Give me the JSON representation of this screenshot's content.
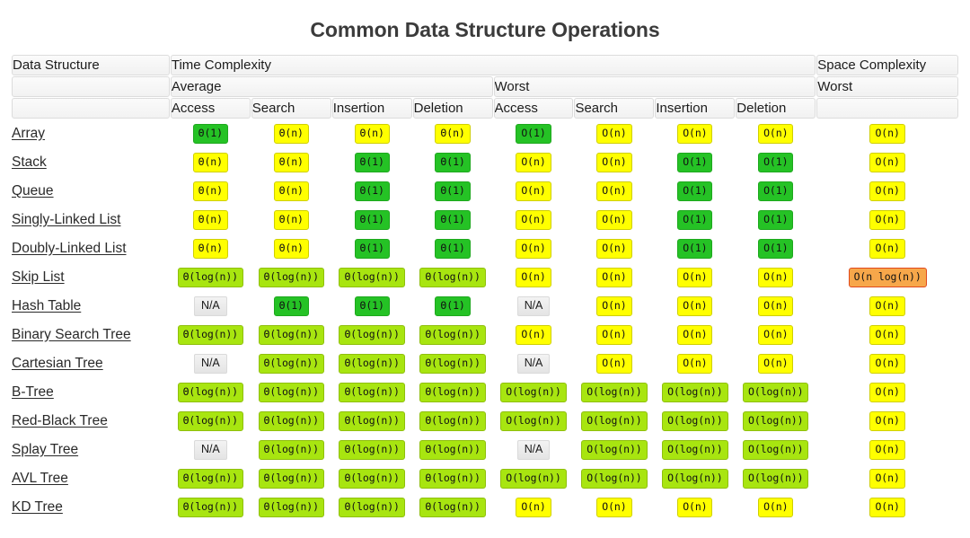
{
  "title": "Common Data Structure Operations",
  "table": {
    "header_row1": [
      {
        "label": "Data Structure",
        "colspan": 1
      },
      {
        "label": "Time Complexity",
        "colspan": 8
      },
      {
        "label": "Space Complexity",
        "colspan": 1
      }
    ],
    "header_row2": [
      {
        "label": "",
        "colspan": 1
      },
      {
        "label": "Average",
        "colspan": 4
      },
      {
        "label": "Worst",
        "colspan": 4
      },
      {
        "label": "Worst",
        "colspan": 1
      }
    ],
    "header_row3": [
      {
        "label": "",
        "colspan": 1
      },
      {
        "label": "Access",
        "colspan": 1
      },
      {
        "label": "Search",
        "colspan": 1
      },
      {
        "label": "Insertion",
        "colspan": 1
      },
      {
        "label": "Deletion",
        "colspan": 1
      },
      {
        "label": "Access",
        "colspan": 1
      },
      {
        "label": "Search",
        "colspan": 1
      },
      {
        "label": "Insertion",
        "colspan": 1
      },
      {
        "label": "Deletion",
        "colspan": 1
      },
      {
        "label": "",
        "colspan": 1
      }
    ],
    "columns": [
      "Data Structure",
      "Average Access",
      "Average Search",
      "Average Insertion",
      "Average Deletion",
      "Worst Access",
      "Worst Search",
      "Worst Insertion",
      "Worst Deletion",
      "Space Worst"
    ],
    "legend_colors": {
      "constant": "#25c225",
      "logarithmic": "#a8e510",
      "linear": "#ffff00",
      "linearithmic": "#f7a74a",
      "not_applicable": "#ebebeb"
    },
    "rows": [
      {
        "name": "Array",
        "cells": [
          {
            "text": "Θ(1)",
            "color": "green"
          },
          {
            "text": "Θ(n)",
            "color": "yellow"
          },
          {
            "text": "Θ(n)",
            "color": "yellow"
          },
          {
            "text": "Θ(n)",
            "color": "yellow"
          },
          {
            "text": "O(1)",
            "color": "green"
          },
          {
            "text": "O(n)",
            "color": "yellow"
          },
          {
            "text": "O(n)",
            "color": "yellow"
          },
          {
            "text": "O(n)",
            "color": "yellow"
          },
          {
            "text": "O(n)",
            "color": "yellow"
          }
        ]
      },
      {
        "name": "Stack",
        "cells": [
          {
            "text": "Θ(n)",
            "color": "yellow"
          },
          {
            "text": "Θ(n)",
            "color": "yellow"
          },
          {
            "text": "Θ(1)",
            "color": "green"
          },
          {
            "text": "Θ(1)",
            "color": "green"
          },
          {
            "text": "O(n)",
            "color": "yellow"
          },
          {
            "text": "O(n)",
            "color": "yellow"
          },
          {
            "text": "O(1)",
            "color": "green"
          },
          {
            "text": "O(1)",
            "color": "green"
          },
          {
            "text": "O(n)",
            "color": "yellow"
          }
        ]
      },
      {
        "name": "Queue",
        "cells": [
          {
            "text": "Θ(n)",
            "color": "yellow"
          },
          {
            "text": "Θ(n)",
            "color": "yellow"
          },
          {
            "text": "Θ(1)",
            "color": "green"
          },
          {
            "text": "Θ(1)",
            "color": "green"
          },
          {
            "text": "O(n)",
            "color": "yellow"
          },
          {
            "text": "O(n)",
            "color": "yellow"
          },
          {
            "text": "O(1)",
            "color": "green"
          },
          {
            "text": "O(1)",
            "color": "green"
          },
          {
            "text": "O(n)",
            "color": "yellow"
          }
        ]
      },
      {
        "name": "Singly-Linked List",
        "cells": [
          {
            "text": "Θ(n)",
            "color": "yellow"
          },
          {
            "text": "Θ(n)",
            "color": "yellow"
          },
          {
            "text": "Θ(1)",
            "color": "green"
          },
          {
            "text": "Θ(1)",
            "color": "green"
          },
          {
            "text": "O(n)",
            "color": "yellow"
          },
          {
            "text": "O(n)",
            "color": "yellow"
          },
          {
            "text": "O(1)",
            "color": "green"
          },
          {
            "text": "O(1)",
            "color": "green"
          },
          {
            "text": "O(n)",
            "color": "yellow"
          }
        ]
      },
      {
        "name": "Doubly-Linked List",
        "cells": [
          {
            "text": "Θ(n)",
            "color": "yellow"
          },
          {
            "text": "Θ(n)",
            "color": "yellow"
          },
          {
            "text": "Θ(1)",
            "color": "green"
          },
          {
            "text": "Θ(1)",
            "color": "green"
          },
          {
            "text": "O(n)",
            "color": "yellow"
          },
          {
            "text": "O(n)",
            "color": "yellow"
          },
          {
            "text": "O(1)",
            "color": "green"
          },
          {
            "text": "O(1)",
            "color": "green"
          },
          {
            "text": "O(n)",
            "color": "yellow"
          }
        ]
      },
      {
        "name": "Skip List",
        "cells": [
          {
            "text": "Θ(log(n))",
            "color": "lime"
          },
          {
            "text": "Θ(log(n))",
            "color": "lime"
          },
          {
            "text": "Θ(log(n))",
            "color": "lime"
          },
          {
            "text": "Θ(log(n))",
            "color": "lime"
          },
          {
            "text": "O(n)",
            "color": "yellow"
          },
          {
            "text": "O(n)",
            "color": "yellow"
          },
          {
            "text": "O(n)",
            "color": "yellow"
          },
          {
            "text": "O(n)",
            "color": "yellow"
          },
          {
            "text": "O(n log(n))",
            "color": "orange"
          }
        ]
      },
      {
        "name": "Hash Table",
        "cells": [
          {
            "text": "N/A",
            "color": "na"
          },
          {
            "text": "Θ(1)",
            "color": "green"
          },
          {
            "text": "Θ(1)",
            "color": "green"
          },
          {
            "text": "Θ(1)",
            "color": "green"
          },
          {
            "text": "N/A",
            "color": "na"
          },
          {
            "text": "O(n)",
            "color": "yellow"
          },
          {
            "text": "O(n)",
            "color": "yellow"
          },
          {
            "text": "O(n)",
            "color": "yellow"
          },
          {
            "text": "O(n)",
            "color": "yellow"
          }
        ]
      },
      {
        "name": "Binary Search Tree",
        "cells": [
          {
            "text": "Θ(log(n))",
            "color": "lime"
          },
          {
            "text": "Θ(log(n))",
            "color": "lime"
          },
          {
            "text": "Θ(log(n))",
            "color": "lime"
          },
          {
            "text": "Θ(log(n))",
            "color": "lime"
          },
          {
            "text": "O(n)",
            "color": "yellow"
          },
          {
            "text": "O(n)",
            "color": "yellow"
          },
          {
            "text": "O(n)",
            "color": "yellow"
          },
          {
            "text": "O(n)",
            "color": "yellow"
          },
          {
            "text": "O(n)",
            "color": "yellow"
          }
        ]
      },
      {
        "name": "Cartesian Tree",
        "cells": [
          {
            "text": "N/A",
            "color": "na"
          },
          {
            "text": "Θ(log(n))",
            "color": "lime"
          },
          {
            "text": "Θ(log(n))",
            "color": "lime"
          },
          {
            "text": "Θ(log(n))",
            "color": "lime"
          },
          {
            "text": "N/A",
            "color": "na"
          },
          {
            "text": "O(n)",
            "color": "yellow"
          },
          {
            "text": "O(n)",
            "color": "yellow"
          },
          {
            "text": "O(n)",
            "color": "yellow"
          },
          {
            "text": "O(n)",
            "color": "yellow"
          }
        ]
      },
      {
        "name": "B-Tree",
        "cells": [
          {
            "text": "Θ(log(n))",
            "color": "lime"
          },
          {
            "text": "Θ(log(n))",
            "color": "lime"
          },
          {
            "text": "Θ(log(n))",
            "color": "lime"
          },
          {
            "text": "Θ(log(n))",
            "color": "lime"
          },
          {
            "text": "O(log(n))",
            "color": "lime"
          },
          {
            "text": "O(log(n))",
            "color": "lime"
          },
          {
            "text": "O(log(n))",
            "color": "lime"
          },
          {
            "text": "O(log(n))",
            "color": "lime"
          },
          {
            "text": "O(n)",
            "color": "yellow"
          }
        ]
      },
      {
        "name": "Red-Black Tree",
        "cells": [
          {
            "text": "Θ(log(n))",
            "color": "lime"
          },
          {
            "text": "Θ(log(n))",
            "color": "lime"
          },
          {
            "text": "Θ(log(n))",
            "color": "lime"
          },
          {
            "text": "Θ(log(n))",
            "color": "lime"
          },
          {
            "text": "O(log(n))",
            "color": "lime"
          },
          {
            "text": "O(log(n))",
            "color": "lime"
          },
          {
            "text": "O(log(n))",
            "color": "lime"
          },
          {
            "text": "O(log(n))",
            "color": "lime"
          },
          {
            "text": "O(n)",
            "color": "yellow"
          }
        ]
      },
      {
        "name": "Splay Tree",
        "cells": [
          {
            "text": "N/A",
            "color": "na"
          },
          {
            "text": "Θ(log(n))",
            "color": "lime"
          },
          {
            "text": "Θ(log(n))",
            "color": "lime"
          },
          {
            "text": "Θ(log(n))",
            "color": "lime"
          },
          {
            "text": "N/A",
            "color": "na"
          },
          {
            "text": "O(log(n))",
            "color": "lime"
          },
          {
            "text": "O(log(n))",
            "color": "lime"
          },
          {
            "text": "O(log(n))",
            "color": "lime"
          },
          {
            "text": "O(n)",
            "color": "yellow"
          }
        ]
      },
      {
        "name": "AVL Tree",
        "cells": [
          {
            "text": "Θ(log(n))",
            "color": "lime"
          },
          {
            "text": "Θ(log(n))",
            "color": "lime"
          },
          {
            "text": "Θ(log(n))",
            "color": "lime"
          },
          {
            "text": "Θ(log(n))",
            "color": "lime"
          },
          {
            "text": "O(log(n))",
            "color": "lime"
          },
          {
            "text": "O(log(n))",
            "color": "lime"
          },
          {
            "text": "O(log(n))",
            "color": "lime"
          },
          {
            "text": "O(log(n))",
            "color": "lime"
          },
          {
            "text": "O(n)",
            "color": "yellow"
          }
        ]
      },
      {
        "name": "KD Tree",
        "cells": [
          {
            "text": "Θ(log(n))",
            "color": "lime"
          },
          {
            "text": "Θ(log(n))",
            "color": "lime"
          },
          {
            "text": "Θ(log(n))",
            "color": "lime"
          },
          {
            "text": "Θ(log(n))",
            "color": "lime"
          },
          {
            "text": "O(n)",
            "color": "yellow"
          },
          {
            "text": "O(n)",
            "color": "yellow"
          },
          {
            "text": "O(n)",
            "color": "yellow"
          },
          {
            "text": "O(n)",
            "color": "yellow"
          },
          {
            "text": "O(n)",
            "color": "yellow"
          }
        ]
      }
    ]
  }
}
